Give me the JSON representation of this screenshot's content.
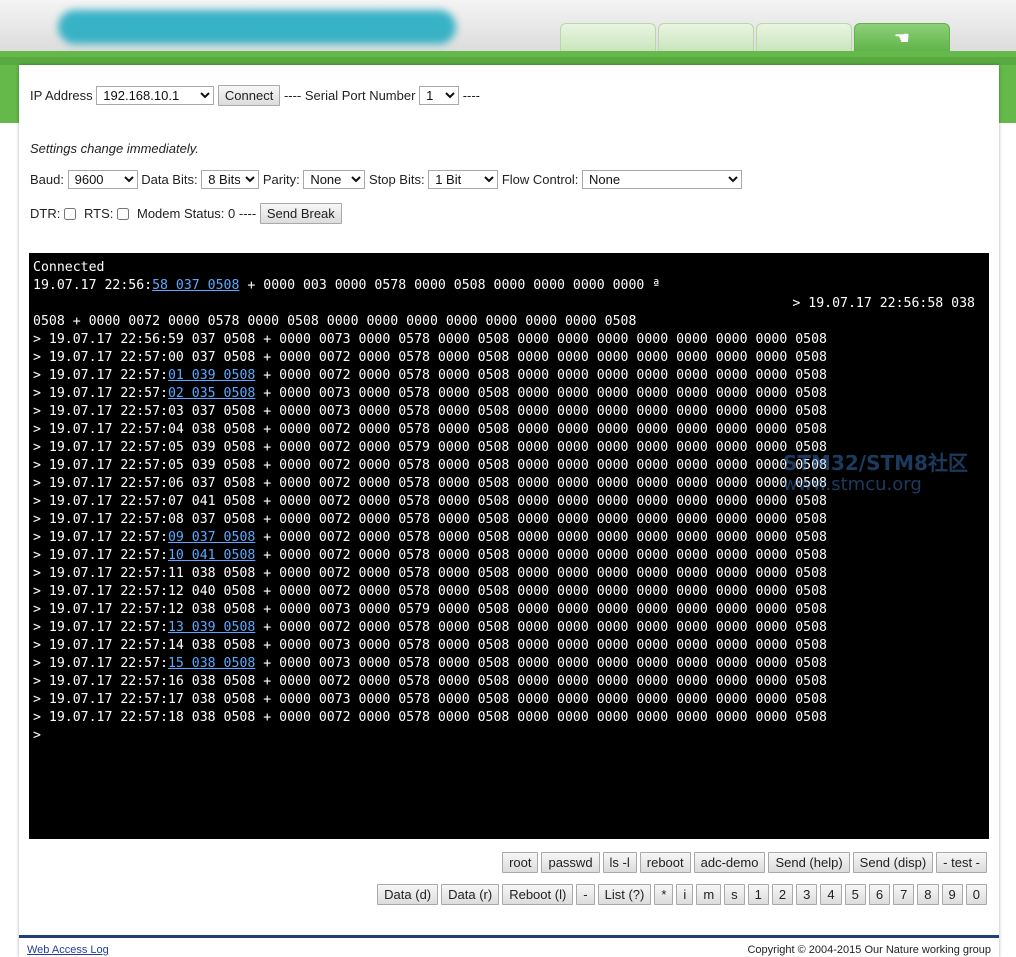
{
  "header": {
    "tabs": [
      {
        "label": ""
      },
      {
        "label": ""
      },
      {
        "label": ""
      },
      {
        "label": "",
        "icon": "hand-icon",
        "active": true
      }
    ],
    "colors": {
      "green": "#65b84a",
      "terminal_bg": "#000000",
      "link": "#5aa9ff"
    }
  },
  "connection": {
    "ip_label": "IP Address",
    "ip_value": "192.168.10.1",
    "connect_label": "Connect",
    "separator1": "----",
    "serial_label": "Serial Port Number",
    "serial_value": "1",
    "separator2": "----"
  },
  "settings": {
    "note": "Settings change immediately.",
    "baud_label": "Baud:",
    "baud_value": "9600",
    "databits_label": "Data Bits:",
    "databits_value": "8 Bits",
    "parity_label": "Parity:",
    "parity_value": "None",
    "stopbits_label": "Stop Bits:",
    "stopbits_value": "1 Bit",
    "flow_label": "Flow Control:",
    "flow_value": "None",
    "dtr_label": "DTR:",
    "rts_label": "RTS:",
    "modem_label": "Modem Status: 0",
    "separator": "----",
    "send_break_label": "Send Break"
  },
  "terminal": {
    "lines": [
      {
        "pre": "Connected",
        "link": "",
        "post": ""
      },
      {
        "pre": "19.07.17 22:56:",
        "link": "58 037 0508",
        "post": " + 0000 003 0000 0578 0000 0508 0000 0000 0000 0000 ª"
      },
      {
        "pre": "> 19.07.17 22:56:58 038",
        "link": "",
        "post": "",
        "align": "right"
      },
      {
        "pre": "0508 + 0000 0072 0000 0578 0000 0508 0000 0000 0000 0000 0000 0000 0000 0508",
        "link": "",
        "post": ""
      },
      {
        "pre": "> 19.07.17 22:56:59 037 0508 + 0000 0073 0000 0578 0000 0508 0000 0000 0000 0000 0000 0000 0000 0508",
        "link": "",
        "post": ""
      },
      {
        "pre": "> 19.07.17 22:57:00 037 0508 + 0000 0072 0000 0578 0000 0508 0000 0000 0000 0000 0000 0000 0000 0508",
        "link": "",
        "post": ""
      },
      {
        "pre": "> 19.07.17 22:57:",
        "link": "01 039 0508",
        "post": " + 0000 0072 0000 0578 0000 0508 0000 0000 0000 0000 0000 0000 0000 0508"
      },
      {
        "pre": "> 19.07.17 22:57:",
        "link": "02 035 0508",
        "post": " + 0000 0073 0000 0578 0000 0508 0000 0000 0000 0000 0000 0000 0000 0508"
      },
      {
        "pre": "> 19.07.17 22:57:03 037 0508 + 0000 0073 0000 0578 0000 0508 0000 0000 0000 0000 0000 0000 0000 0508",
        "link": "",
        "post": ""
      },
      {
        "pre": "> 19.07.17 22:57:04 038 0508 + 0000 0072 0000 0578 0000 0508 0000 0000 0000 0000 0000 0000 0000 0508",
        "link": "",
        "post": ""
      },
      {
        "pre": "> 19.07.17 22:57:05 039 0508 + 0000 0072 0000 0579 0000 0508 0000 0000 0000 0000 0000 0000 0000 0508",
        "link": "",
        "post": ""
      },
      {
        "pre": "> 19.07.17 22:57:05 039 0508 + 0000 0072 0000 0578 0000 0508 0000 0000 0000 0000 0000 0000 0000 0508",
        "link": "",
        "post": ""
      },
      {
        "pre": "> 19.07.17 22:57:06 037 0508 + 0000 0072 0000 0578 0000 0508 0000 0000 0000 0000 0000 0000 0000 0508",
        "link": "",
        "post": ""
      },
      {
        "pre": "> 19.07.17 22:57:07 041 0508 + 0000 0072 0000 0578 0000 0508 0000 0000 0000 0000 0000 0000 0000 0508",
        "link": "",
        "post": ""
      },
      {
        "pre": "> 19.07.17 22:57:08 037 0508 + 0000 0072 0000 0578 0000 0508 0000 0000 0000 0000 0000 0000 0000 0508",
        "link": "",
        "post": ""
      },
      {
        "pre": "> 19.07.17 22:57:",
        "link": "09 037 0508",
        "post": " + 0000 0072 0000 0578 0000 0508 0000 0000 0000 0000 0000 0000 0000 0508"
      },
      {
        "pre": "> 19.07.17 22:57:",
        "link": "10 041 0508",
        "post": " + 0000 0072 0000 0578 0000 0508 0000 0000 0000 0000 0000 0000 0000 0508"
      },
      {
        "pre": "> 19.07.17 22:57:11 038 0508 + 0000 0072 0000 0578 0000 0508 0000 0000 0000 0000 0000 0000 0000 0508",
        "link": "",
        "post": ""
      },
      {
        "pre": "> 19.07.17 22:57:12 040 0508 + 0000 0072 0000 0578 0000 0508 0000 0000 0000 0000 0000 0000 0000 0508",
        "link": "",
        "post": ""
      },
      {
        "pre": "> 19.07.17 22:57:12 038 0508 + 0000 0073 0000 0579 0000 0508 0000 0000 0000 0000 0000 0000 0000 0508",
        "link": "",
        "post": ""
      },
      {
        "pre": "> 19.07.17 22:57:",
        "link": "13 039 0508",
        "post": " + 0000 0072 0000 0578 0000 0508 0000 0000 0000 0000 0000 0000 0000 0508"
      },
      {
        "pre": "> 19.07.17 22:57:14 038 0508 + 0000 0073 0000 0578 0000 0508 0000 0000 0000 0000 0000 0000 0000 0508",
        "link": "",
        "post": ""
      },
      {
        "pre": "> 19.07.17 22:57:",
        "link": "15 038 0508",
        "post": " + 0000 0073 0000 0578 0000 0508 0000 0000 0000 0000 0000 0000 0000 0508"
      },
      {
        "pre": "> 19.07.17 22:57:16 038 0508 + 0000 0072 0000 0578 0000 0508 0000 0000 0000 0000 0000 0000 0000 0508",
        "link": "",
        "post": ""
      },
      {
        "pre": "> 19.07.17 22:57:17 038 0508 + 0000 0073 0000 0578 0000 0508 0000 0000 0000 0000 0000 0000 0000 0508",
        "link": "",
        "post": ""
      },
      {
        "pre": "> 19.07.17 22:57:18 038 0508 + 0000 0072 0000 0578 0000 0508 0000 0000 0000 0000 0000 0000 0000 0508",
        "link": "",
        "post": ""
      },
      {
        "pre": ">",
        "link": "",
        "post": ""
      }
    ]
  },
  "watermark": {
    "line1": "STM32/STM8社区",
    "line2": "www.stmcu.org"
  },
  "command_buttons_row1": [
    "root",
    "passwd",
    "ls -l",
    "reboot",
    "adc-demo",
    "Send (help)",
    "Send (disp)",
    "- test -"
  ],
  "command_buttons_row2": [
    "Data (d)",
    "Data (r)",
    "Reboot (l)",
    "-",
    "List (?)",
    "*",
    "i",
    "m",
    "s",
    "1",
    "2",
    "3",
    "4",
    "5",
    "6",
    "7",
    "8",
    "9",
    "0"
  ],
  "footer": {
    "log_link": "Web Access Log",
    "copyright": "Copyright © 2004-2015 Our Nature working group"
  }
}
